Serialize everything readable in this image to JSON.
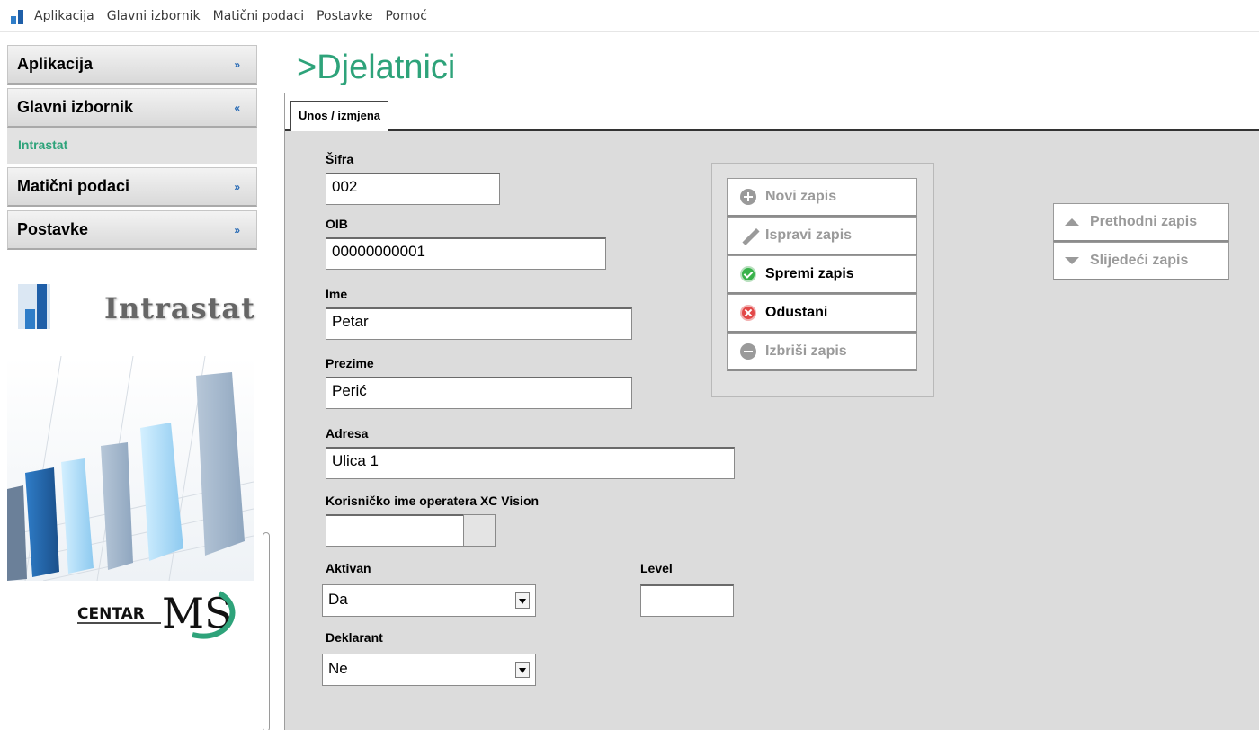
{
  "menubar": {
    "items": [
      "Aplikacija",
      "Glavni izbornik",
      "Matični podaci",
      "Postavke",
      "Pomoć"
    ]
  },
  "sidebar": {
    "sections": [
      {
        "label": "Aplikacija",
        "state": "collapsed"
      },
      {
        "label": "Glavni izbornik",
        "state": "expanded",
        "items": [
          "Intrastat"
        ]
      },
      {
        "label": "Matični podaci",
        "state": "collapsed"
      },
      {
        "label": "Postavke",
        "state": "collapsed"
      }
    ],
    "logo_text": "Intrastat",
    "centar_logo_text": "CENTAR",
    "centar_logo_ms": "MS"
  },
  "page": {
    "title": ">Djelatnici",
    "tab": "Unos / izmjena"
  },
  "form": {
    "sifra": {
      "label": "Šifra",
      "value": "002"
    },
    "oib": {
      "label": "OIB",
      "value": "00000000001"
    },
    "ime": {
      "label": "Ime",
      "value": "Petar"
    },
    "prezime": {
      "label": "Prezime",
      "value": "Perić"
    },
    "adresa": {
      "label": "Adresa",
      "value": "Ulica 1"
    },
    "korisnicko": {
      "label": "Korisničko ime operatera XC Vision",
      "value": ""
    },
    "aktivan": {
      "label": "Aktivan",
      "value": "Da"
    },
    "level": {
      "label": "Level",
      "value": ""
    },
    "deklarant": {
      "label": "Deklarant",
      "value": "Ne"
    }
  },
  "actions": {
    "novi": "Novi zapis",
    "ispravi": "Ispravi zapis",
    "spremi": "Spremi zapis",
    "odustani": "Odustani",
    "izbrisi": "Izbriši zapis"
  },
  "navigation": {
    "prethodni": "Prethodni zapis",
    "sljedeci": "Slijedeći zapis"
  },
  "colors": {
    "accent": "#2ea37a",
    "brand_blue": "#1f5fa8"
  }
}
